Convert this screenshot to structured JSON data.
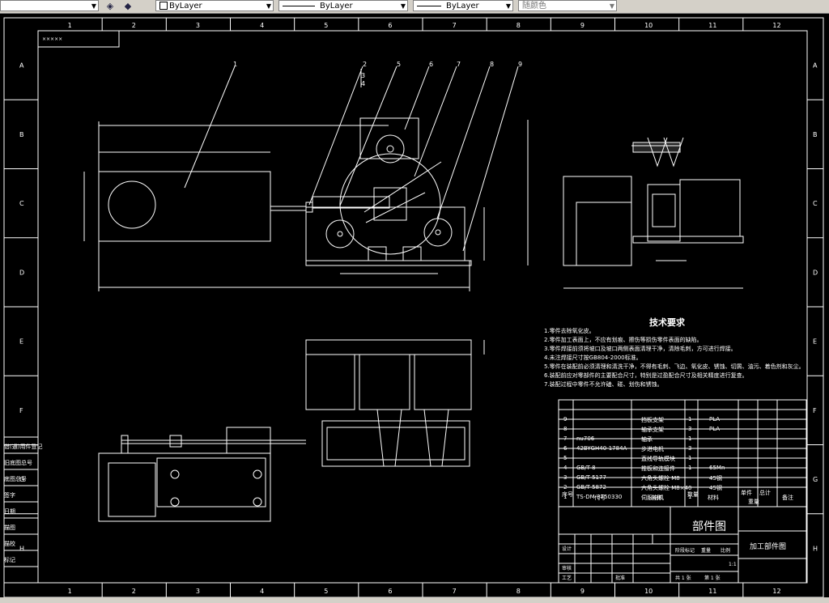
{
  "toolbar": {
    "layer_value": "ByLayer",
    "linetype_value": "ByLayer",
    "lineweight_value": "ByLayer",
    "color_value": "随颜色"
  },
  "grid_columns": [
    "1",
    "2",
    "3",
    "4",
    "5",
    "6",
    "7",
    "8",
    "9",
    "10",
    "11",
    "12"
  ],
  "grid_rows": [
    "A",
    "B",
    "C",
    "D",
    "E",
    "F",
    "G",
    "H"
  ],
  "tech_requirements": {
    "title": "技术要求",
    "items": [
      "1.零件去除氧化皮。",
      "2.零件加工表面上，不应有划痕、擦伤等损伤零件表面的缺陷。",
      "3.零件焊接前须将坡口及坡口两侧表面清理干净，清除毛刺，方可进行焊接。",
      "4.未注焊接尺寸按GB804-2000标准。",
      "5.零件在装配前必须清理和清洗干净，不得有毛刺、飞边、氧化皮、锈蚀、切屑、油污、着色剂和灰尘。",
      "6.装配前应对零部件的主要配合尺寸，特别是过盈配合尺寸及相关精度进行复查。",
      "7.装配过程中零件不允许磕、碰、划伤和锈蚀。"
    ]
  },
  "bom_rows": [
    {
      "no": "9",
      "code": "",
      "name": "挡板支架",
      "qty": "1",
      "material": "PLA"
    },
    {
      "no": "8",
      "code": "",
      "name": "轴承支架",
      "qty": "3",
      "material": "PLA"
    },
    {
      "no": "7",
      "code": "nu706",
      "name": "轴承",
      "qty": "1",
      "material": ""
    },
    {
      "no": "6",
      "code": "42BYGH40-1784A",
      "name": "步进电机",
      "qty": "3",
      "material": ""
    },
    {
      "no": "5",
      "code": "",
      "name": "直线导轨模块",
      "qty": "1",
      "material": ""
    },
    {
      "no": "4",
      "code": "GB/T 8",
      "name": "推板和连接件",
      "qty": "1",
      "material": "65Mn"
    },
    {
      "no": "3",
      "code": "GB/T 5177",
      "name": "六角头螺栓 M8",
      "qty": "",
      "material": "45钢"
    },
    {
      "no": "2",
      "code": "GB/T 5872",
      "name": "六角头螺栓 M8×40",
      "qty": "",
      "material": "45钢"
    },
    {
      "no": "1",
      "code": "TS-DM-3750330",
      "name": "伺服电机",
      "qty": "1",
      "material": ""
    }
  ],
  "bom_header": {
    "no": "序号",
    "code": "代号",
    "name": "名称",
    "qty": "数量",
    "material": "材料",
    "unit_weight": "单件",
    "total_weight": "总计",
    "weight": "重量",
    "remark": "备注"
  },
  "title_block": {
    "drawing_name": "部件图",
    "part_name": "加工部件图",
    "scale": "1:1",
    "sheet": "共 1 张",
    "sheet_no": "第 1 张",
    "design": "设计",
    "check": "审核",
    "process": "工艺",
    "approve": "批准",
    "stage_label": "阶段标记",
    "weight_label": "重量",
    "scale_label": "比例"
  },
  "sidebar_labels": [
    "借(通)用件登记",
    "旧底图总号",
    "底图总号",
    "签字",
    "日期",
    "描图",
    "描校",
    "标记"
  ],
  "balloons": [
    "1",
    "2",
    "3",
    "4",
    "5",
    "6",
    "7",
    "8",
    "9"
  ],
  "corner_note": "×××××"
}
